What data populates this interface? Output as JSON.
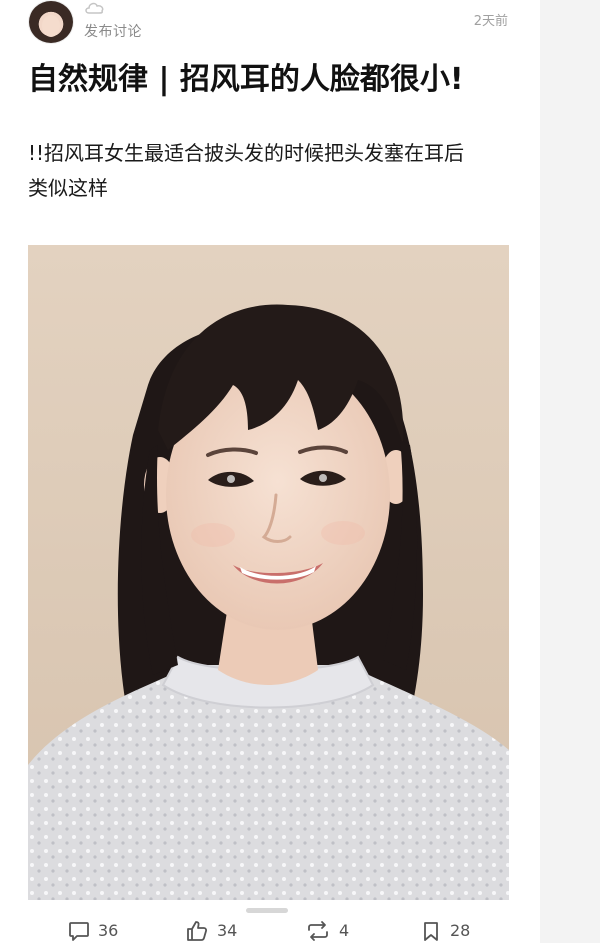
{
  "header": {
    "subtitle": "发布讨论",
    "time_ago": "2天前"
  },
  "post": {
    "title": "自然规律 | 招风耳的人脸都很小!",
    "body_line1": "!!招风耳女生最适合披头发的时候把头发塞在耳后",
    "body_line2": "类似这样"
  },
  "actions": {
    "comments": "36",
    "likes": "34",
    "reposts": "4",
    "favorites": "28"
  },
  "icons": {
    "header": [
      "avatar",
      "cloud-icon"
    ],
    "actions": [
      "comment-icon",
      "like-icon",
      "repost-icon",
      "bookmark-icon"
    ]
  },
  "colors": {
    "photo_background": "#ddcbb8",
    "meta_text": "#8a8a8a"
  }
}
